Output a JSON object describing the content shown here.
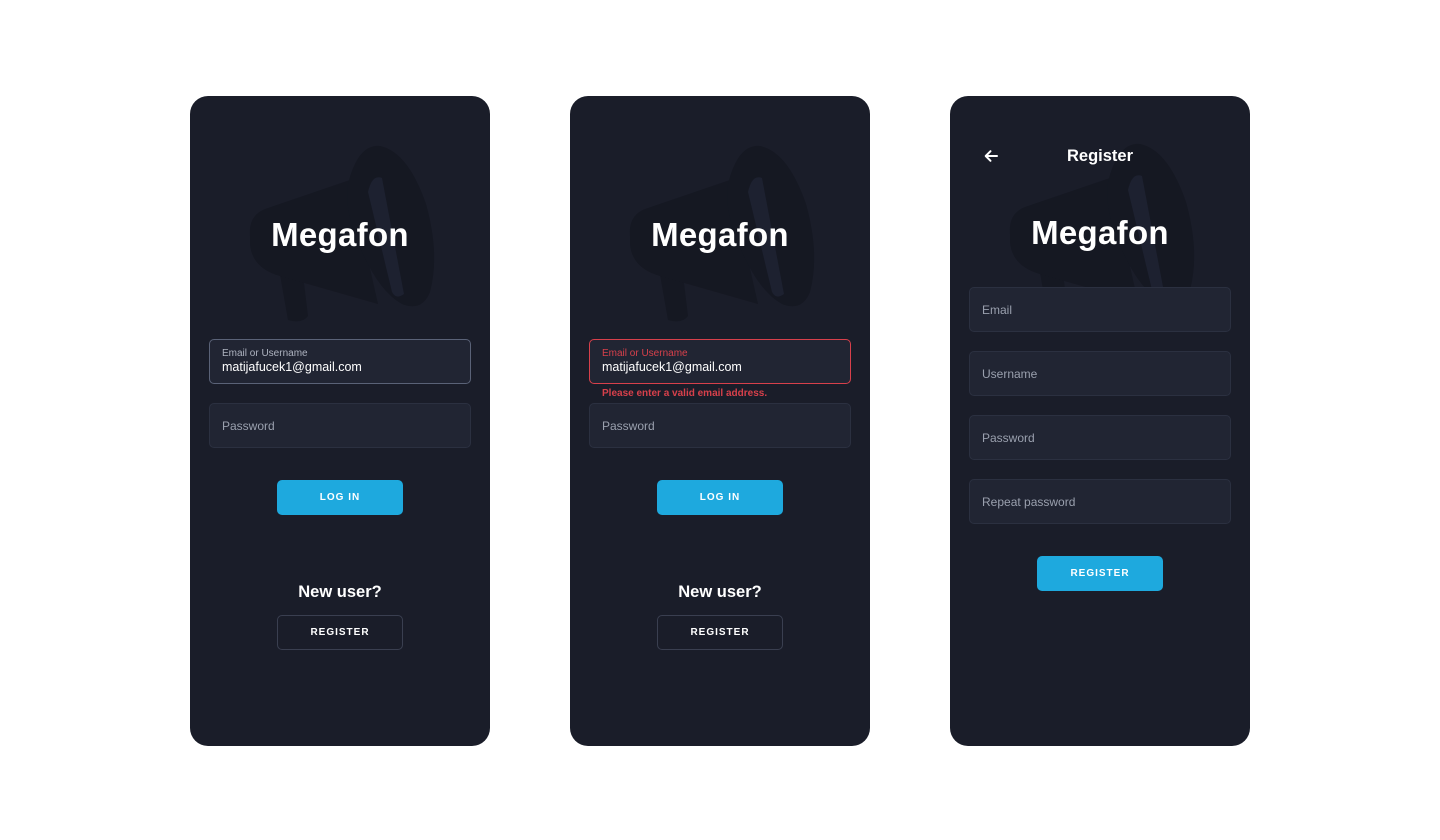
{
  "brand": "Megafon",
  "icons": {
    "background": "megaphone-icon",
    "back": "arrow-left-icon"
  },
  "colors": {
    "screen_bg": "#1a1d29",
    "field_bg": "#212533",
    "accent": "#1ea9de",
    "error": "#d7404b",
    "text": "#ffffff",
    "muted": "#9aa0ae"
  },
  "login": {
    "email_label": "Email or Username",
    "email_value": "matijafucek1@gmail.com",
    "password_placeholder": "Password",
    "login_button": "LOG IN",
    "new_user": "New user?",
    "register_button": "REGISTER"
  },
  "login_error": {
    "email_label": "Email or Username",
    "email_value": "matijafucek1@gmail.com",
    "error_message": "Please enter a valid email address.",
    "password_placeholder": "Password",
    "login_button": "LOG IN",
    "new_user": "New user?",
    "register_button": "REGISTER"
  },
  "register": {
    "title": "Register",
    "email_placeholder": "Email",
    "username_placeholder": "Username",
    "password_placeholder": "Password",
    "repeat_password_placeholder": "Repeat password",
    "register_button": "REGISTER"
  }
}
